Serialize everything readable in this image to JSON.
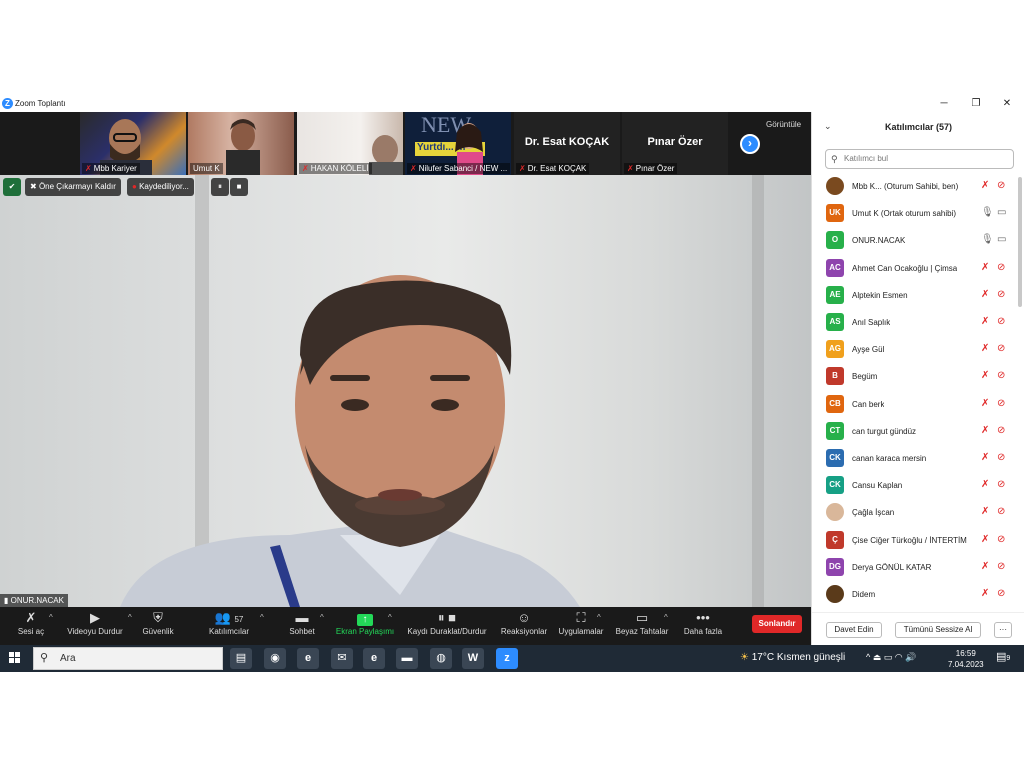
{
  "window": {
    "title": "Zoom Toplantı",
    "minimize": "─",
    "maximize": "❐",
    "close": "✕"
  },
  "strip": {
    "tiles": [
      {
        "label": "Mbb Kariyer",
        "muted": true,
        "big": ""
      },
      {
        "label": "Umut K",
        "muted": false,
        "big": ""
      },
      {
        "label": "HAKAN KÖLELİ",
        "muted": true,
        "big": ""
      },
      {
        "label": "Nilufer Sabanci / NEW ...",
        "muted": true,
        "big": ""
      },
      {
        "label": "Dr. Esat KOÇAK",
        "muted": true,
        "big": "Dr. Esat KOÇAK"
      },
      {
        "label": "Pınar Özer",
        "muted": true,
        "big": "Pınar Özer"
      }
    ],
    "next_icon": "›",
    "view_label": "Görüntüle",
    "tile3_logo_top": "NEW",
    "tile3_logo_bottom": "Yurtdı... m"
  },
  "overlay": {
    "unpin_label": "Öne Çıkarmayı Kaldır",
    "recording_label": "Kaydediliyor...",
    "pause_icon": "⏸",
    "stop_icon": "■"
  },
  "speaker": {
    "name": "ONUR.NACAK"
  },
  "toolbar": {
    "items": [
      {
        "label": "Sesi aç",
        "icon": "🎤"
      },
      {
        "label": "Videoyu Durdur",
        "icon": "▶"
      },
      {
        "label": "Güvenlik",
        "icon": "🛡"
      },
      {
        "label": "Katılımcılar",
        "icon": "👥",
        "count": "57"
      },
      {
        "label": "Sohbet",
        "icon": "💬"
      },
      {
        "label": "Ekran Paylaşımı",
        "icon": "⬆"
      },
      {
        "label": "Kaydı Duraklat/Durdur",
        "icon": "⏸■"
      },
      {
        "label": "Reaksiyonlar",
        "icon": "☺"
      },
      {
        "label": "Uygulamalar",
        "icon": "⛶"
      },
      {
        "label": "Beyaz Tahtalar",
        "icon": "▭"
      },
      {
        "label": "Daha fazla",
        "icon": "•••"
      }
    ],
    "caret": "^",
    "end_label": "Sonlandır"
  },
  "panel": {
    "title": "Katılımcılar (57)",
    "collapse_icon": "⌄",
    "search_placeholder": "Katılımcı bul",
    "participants": [
      {
        "initials": "",
        "name": "Mbb K... (Oturum Sahibi, ben)",
        "color": "#7a4a1f",
        "mic": "muted",
        "cam": "off"
      },
      {
        "initials": "UK",
        "name": "Umut K (Ortak oturum sahibi)",
        "color": "#e0660f",
        "mic": "on",
        "cam": "on"
      },
      {
        "initials": "O",
        "name": "ONUR.NACAK",
        "color": "#27b04a",
        "mic": "on",
        "cam": "on"
      },
      {
        "initials": "AC",
        "name": "Ahmet Can Ocakoğlu | Çimsa",
        "color": "#8e44ad",
        "mic": "muted",
        "cam": "off"
      },
      {
        "initials": "AE",
        "name": "Alptekin Esmen",
        "color": "#27b04a",
        "mic": "muted",
        "cam": "off"
      },
      {
        "initials": "AS",
        "name": "Anıl Saplık",
        "color": "#27b04a",
        "mic": "muted",
        "cam": "off"
      },
      {
        "initials": "AG",
        "name": "Ayşe Gül",
        "color": "#f0a01c",
        "mic": "muted",
        "cam": "off"
      },
      {
        "initials": "B",
        "name": "Begüm",
        "color": "#c0392b",
        "mic": "muted",
        "cam": "off"
      },
      {
        "initials": "CB",
        "name": "Can berk",
        "color": "#e0660f",
        "mic": "muted",
        "cam": "off"
      },
      {
        "initials": "CT",
        "name": "can turgut gündüz",
        "color": "#27b04a",
        "mic": "muted",
        "cam": "off"
      },
      {
        "initials": "CK",
        "name": "canan karaca mersin",
        "color": "#2b6cb0",
        "mic": "muted",
        "cam": "off"
      },
      {
        "initials": "CK",
        "name": "Cansu Kaplan",
        "color": "#16a085",
        "mic": "muted",
        "cam": "off"
      },
      {
        "initials": "",
        "name": "Çağla İşcan",
        "color": "#d9b79a",
        "mic": "muted",
        "cam": "off"
      },
      {
        "initials": "Ç",
        "name": "Çise Ciğer Türkoğlu / İNTERTİM",
        "color": "#c0392b",
        "mic": "muted",
        "cam": "off"
      },
      {
        "initials": "DG",
        "name": "Derya GÖNÜL KATAR",
        "color": "#8e44ad",
        "mic": "muted",
        "cam": "off"
      },
      {
        "initials": "",
        "name": "Didem",
        "color": "#5a3a1a",
        "mic": "muted",
        "cam": "off"
      }
    ],
    "invite_label": "Davet Edin",
    "mute_all_label": "Tümünü Sessize Al",
    "more_label": "···",
    "mic_on_icon": "🎙",
    "mic_off_icon": "✗",
    "cam_on_icon": "▭",
    "cam_off_icon": "⊘"
  },
  "taskbar": {
    "search_placeholder": "Ara",
    "apps": [
      {
        "name": "files-app",
        "color": "#3a4654",
        "glyph": "▤"
      },
      {
        "name": "chrome-app",
        "color": "#3a4654",
        "glyph": "◉"
      },
      {
        "name": "edge-app",
        "color": "#3a4654",
        "glyph": "e"
      },
      {
        "name": "mail-app",
        "color": "#3a4654",
        "glyph": "✉"
      },
      {
        "name": "ie-app",
        "color": "#3a4654",
        "glyph": "e"
      },
      {
        "name": "explorer-app",
        "color": "#3a4654",
        "glyph": "▬"
      },
      {
        "name": "firefox-app",
        "color": "#3a4654",
        "glyph": "◍"
      },
      {
        "name": "word-app",
        "color": "#3a4654",
        "glyph": "W"
      },
      {
        "name": "zoom-app",
        "color": "#2d8cff",
        "glyph": "z"
      }
    ],
    "weather": "17°C  Kısmen güneşli",
    "tray": "^  ⏏  ▭  ◠  🔊",
    "time": "16:59",
    "date": "7.04.2023",
    "notif_count": "9"
  }
}
